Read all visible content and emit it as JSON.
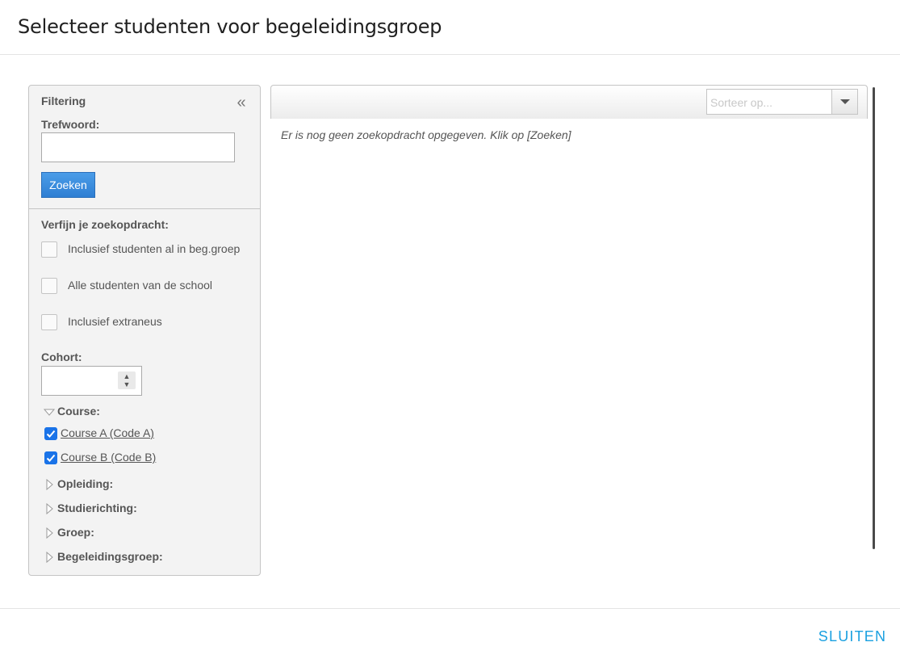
{
  "dialog": {
    "title": "Selecteer studenten voor begeleidingsgroep",
    "close_label": "SLUITEN"
  },
  "filter": {
    "heading": "Filtering",
    "keyword_label": "Trefwoord:",
    "keyword_value": "",
    "search_label": "Zoeken",
    "refine_label": "Verfijn je zoekopdracht:",
    "checkboxes": [
      {
        "label": "Inclusief studenten al in beg.groep",
        "checked": false
      },
      {
        "label": "Alle studenten van de school",
        "checked": false
      },
      {
        "label": "Inclusief extraneus",
        "checked": false
      }
    ],
    "cohort_label": "Cohort:",
    "cohort_value": "",
    "course_label": "Course:",
    "courses": [
      {
        "label": "Course A (Code A)",
        "checked": true
      },
      {
        "label": "Course B (Code B)",
        "checked": true
      }
    ],
    "collapsed_groups": [
      "Opleiding:",
      "Studierichting:",
      "Groep:",
      "Begeleidingsgroep:"
    ]
  },
  "results": {
    "sort_placeholder": "Sorteer op...",
    "empty_message": "Er is nog geen zoekopdracht opgegeven. Klik op [Zoeken]"
  },
  "colors": {
    "accent": "#1aa0e0",
    "button": "#2f7fd3",
    "checkbox": "#1a73e8"
  },
  "icons": {
    "collapse": "double-chevron-left-icon",
    "expanded": "triangle-down-icon",
    "collapsed": "triangle-right-icon"
  }
}
